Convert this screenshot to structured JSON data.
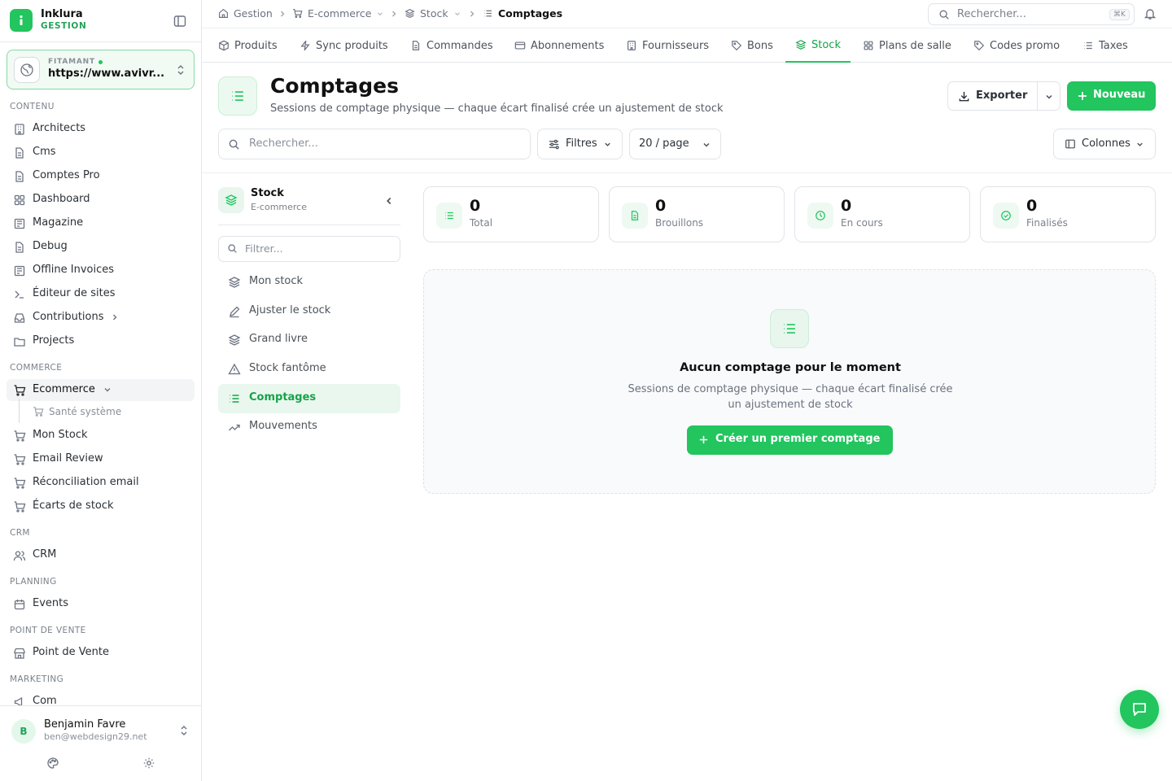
{
  "brand": {
    "name": "Inklura",
    "sub": "GESTION"
  },
  "site": {
    "label": "FITAMANT",
    "url": "https://www.avivr..."
  },
  "sidebar": {
    "sections": [
      "CONTENU",
      "COMMERCE",
      "CRM",
      "PLANNING",
      "POINT DE VENTE",
      "MARKETING"
    ],
    "contenu": [
      "Architects",
      "Cms",
      "Comptes Pro",
      "Dashboard",
      "Magazine",
      "Debug",
      "Offline Invoices",
      "Éditeur de sites",
      "Contributions",
      "Projects"
    ],
    "ecommerce": "Ecommerce",
    "ecommerce_sub": "Santé système",
    "commerce": [
      "Mon Stock",
      "Email Review",
      "Réconciliation email",
      "Écarts de stock"
    ],
    "crm": "CRM",
    "events": "Events",
    "pos": "Point de Vente",
    "com": "Com"
  },
  "user": {
    "initial": "B",
    "name": "Benjamin Favre",
    "email": "ben@webdesign29.net"
  },
  "breadcrumb": [
    "Gestion",
    "E-commerce",
    "Stock",
    "Comptages"
  ],
  "top_search": {
    "placeholder": "Rechercher...",
    "shortcut": "⌘K"
  },
  "tabs": [
    "Produits",
    "Sync produits",
    "Commandes",
    "Abonnements",
    "Fournisseurs",
    "Bons",
    "Stock",
    "Plans de salle",
    "Codes promo",
    "Taxes"
  ],
  "header": {
    "title": "Comptages",
    "subtitle": "Sessions de comptage physique — chaque écart finalisé crée un ajustement de stock",
    "export": "Exporter",
    "new": "Nouveau"
  },
  "filters": {
    "search_placeholder": "Rechercher...",
    "filters": "Filtres",
    "per_page": "20 / page",
    "columns": "Colonnes"
  },
  "subnav": {
    "title": "Stock",
    "subtitle": "E-commerce",
    "filter_placeholder": "Filtrer...",
    "items": [
      "Mon stock",
      "Ajuster le stock",
      "Grand livre",
      "Stock fantôme",
      "Comptages",
      "Mouvements"
    ]
  },
  "stats": [
    {
      "value": "0",
      "label": "Total"
    },
    {
      "value": "0",
      "label": "Brouillons"
    },
    {
      "value": "0",
      "label": "En cours"
    },
    {
      "value": "0",
      "label": "Finalisés"
    }
  ],
  "empty": {
    "title": "Aucun comptage pour le moment",
    "desc": "Sessions de comptage physique — chaque écart finalisé crée un ajustement de stock",
    "button": "Créer un premier comptage"
  },
  "colors": {
    "accent": "#22c55e",
    "accent_text": "#16a34a"
  }
}
